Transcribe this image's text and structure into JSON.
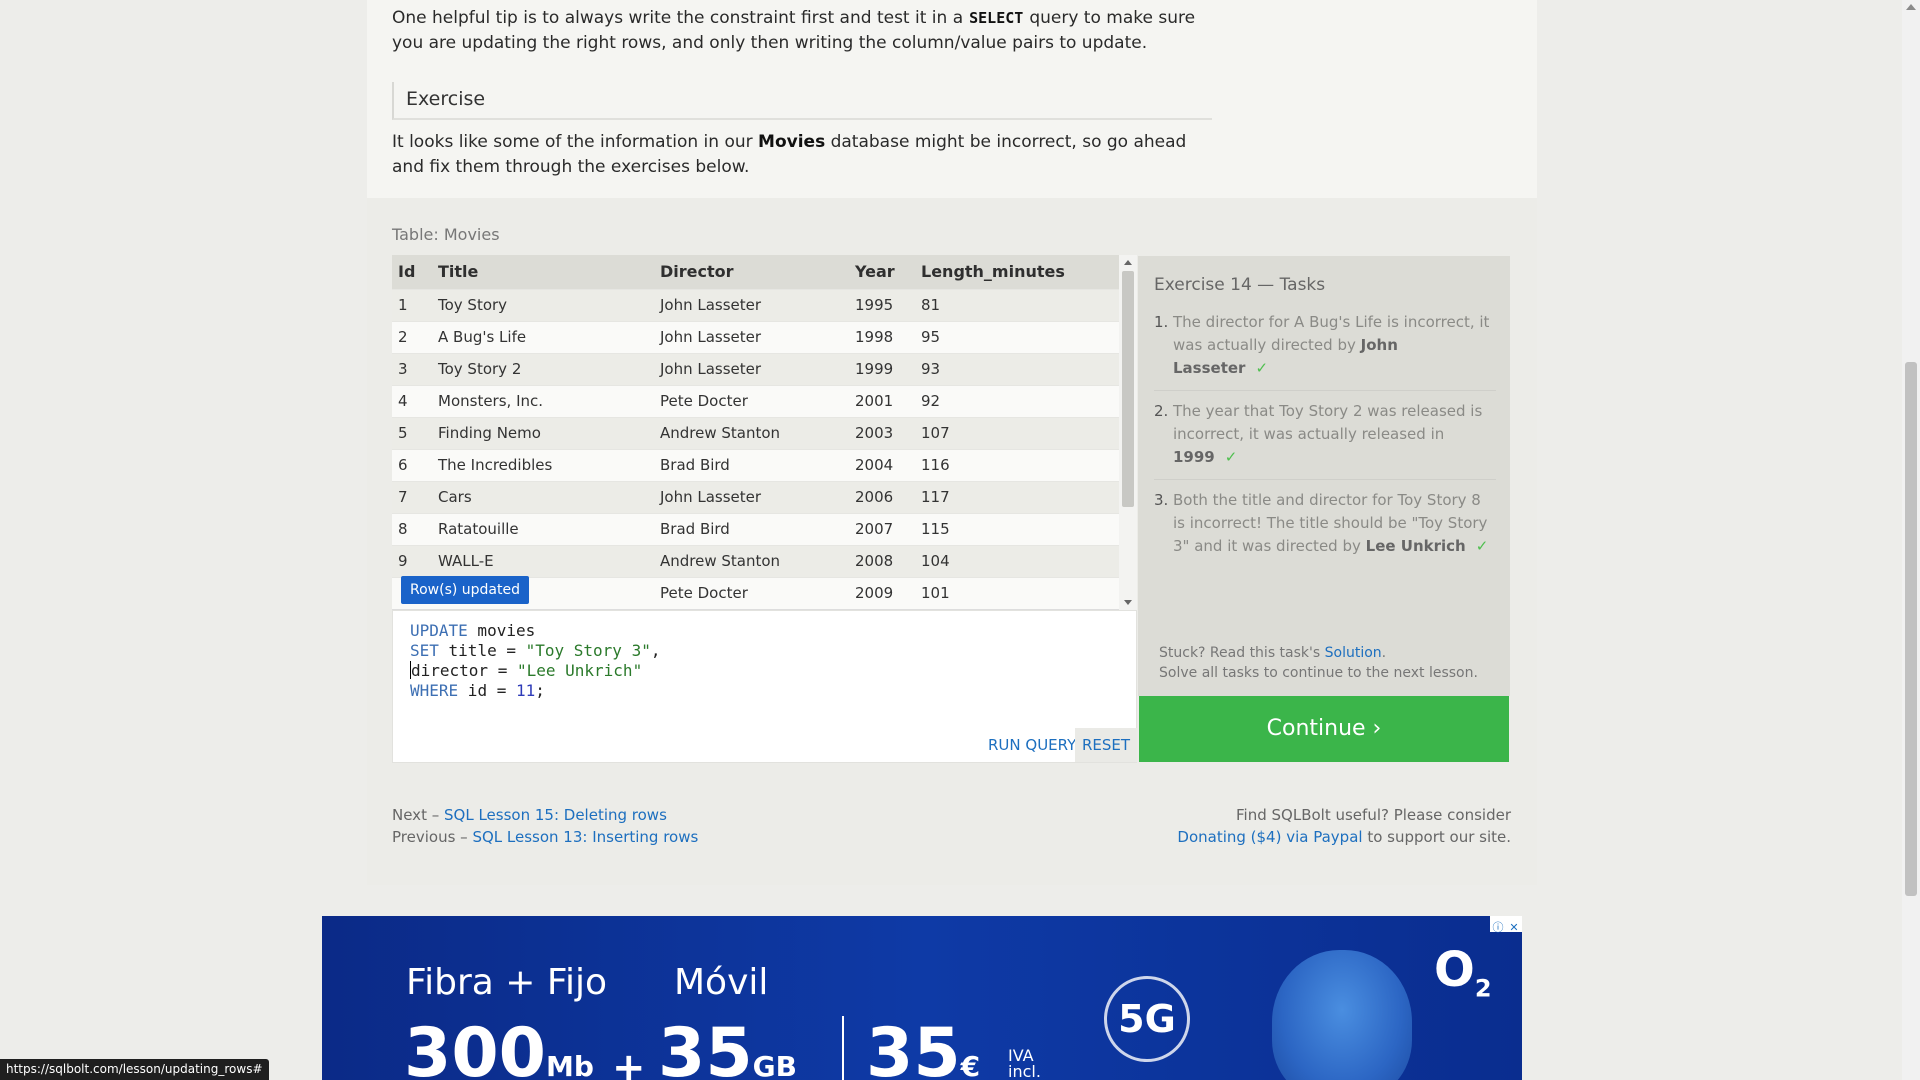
{
  "lesson": {
    "tip_before": "One helpful tip is to always write the constraint first and test it in a",
    "tip_keyword": "SELECT",
    "tip_after": "query to make sure you are updating the right rows, and only then writing the column/value pairs to update.",
    "exercise_heading": "Exercise",
    "exercise_before": "It looks like some of the information in our",
    "exercise_bold": "Movies",
    "exercise_after": "database might be incorrect, so go ahead and fix them through the exercises below."
  },
  "table": {
    "caption": "Table: Movies",
    "columns": [
      "Id",
      "Title",
      "Director",
      "Year",
      "Length_minutes"
    ],
    "rows": [
      [
        "1",
        "Toy Story",
        "John Lasseter",
        "1995",
        "81"
      ],
      [
        "2",
        "A Bug's Life",
        "John Lasseter",
        "1998",
        "95"
      ],
      [
        "3",
        "Toy Story 2",
        "John Lasseter",
        "1999",
        "93"
      ],
      [
        "4",
        "Monsters, Inc.",
        "Pete Docter",
        "2001",
        "92"
      ],
      [
        "5",
        "Finding Nemo",
        "Andrew Stanton",
        "2003",
        "107"
      ],
      [
        "6",
        "The Incredibles",
        "Brad Bird",
        "2004",
        "116"
      ],
      [
        "7",
        "Cars",
        "John Lasseter",
        "2006",
        "117"
      ],
      [
        "8",
        "Ratatouille",
        "Brad Bird",
        "2007",
        "115"
      ],
      [
        "9",
        "WALL-E",
        "Andrew Stanton",
        "2008",
        "104"
      ],
      [
        "",
        "",
        "Pete Docter",
        "2009",
        "101"
      ]
    ],
    "toast": "Row(s) updated"
  },
  "editor": {
    "line1_kw": "UPDATE",
    "line1_rest": " movies",
    "line2_kw": "SET",
    "line2_mid": " title = ",
    "line2_str": "\"Toy Story 3\"",
    "line2_end": ",",
    "line3_rest": "director = ",
    "line3_str": "\"Lee Unkrich\"",
    "line4_kw": "WHERE",
    "line4_mid": " id = ",
    "line4_num": "11",
    "line4_end": ";",
    "run_label": "RUN QUERY",
    "reset_label": "RESET"
  },
  "tasks": {
    "title": "Exercise 14 — Tasks",
    "items": [
      {
        "num": "1.",
        "text": "The director for A Bug's Life is incorrect, it was actually directed by",
        "bold": "John Lasseter",
        "check": "✓"
      },
      {
        "num": "2.",
        "text": "The year that Toy Story 2 was released is incorrect, it was actually released in",
        "bold": "1999",
        "check": "✓"
      },
      {
        "num": "3.",
        "text": "Both the title and director for Toy Story 8 is incorrect! The title should be \"Toy Story 3\" and it was directed by",
        "bold": "Lee Unkrich",
        "check": "✓"
      }
    ],
    "stuck_prefix": "Stuck? Read this task's",
    "solution_link": "Solution",
    "stuck_suffix": ".",
    "stuck_line2": "Solve all tasks to continue to the next lesson.",
    "continue_label": "Continue ›"
  },
  "footer_nav": {
    "next_prefix": "Next –",
    "next_link": "SQL Lesson 15: Deleting rows",
    "prev_prefix": "Previous –",
    "prev_link": "SQL Lesson 13: Inserting rows",
    "support_line1": "Find SQLBolt useful? Please consider",
    "support_link": "Donating ($4) via Paypal",
    "support_suffix": "to support our site."
  },
  "ad": {
    "headline1": "Fibra + Fijo",
    "headline2": "Móvil",
    "speed": "300",
    "speed_unit": "Mb",
    "plus": "+",
    "data": "35",
    "data_unit": "GB",
    "price": "35",
    "currency": "€",
    "iva": "IVA",
    "iva2": "incl.",
    "g5": "5G",
    "brand": "O",
    "brand_sub": "2",
    "info_badge": "ⓘ",
    "close_badge": "✕",
    "colors": {
      "background": "#0e3aa6",
      "continue": "#3bb54a",
      "link": "#1d6fbf"
    }
  },
  "statusbar": {
    "url": "https://sqlbolt.com/lesson/updating_rows#"
  }
}
